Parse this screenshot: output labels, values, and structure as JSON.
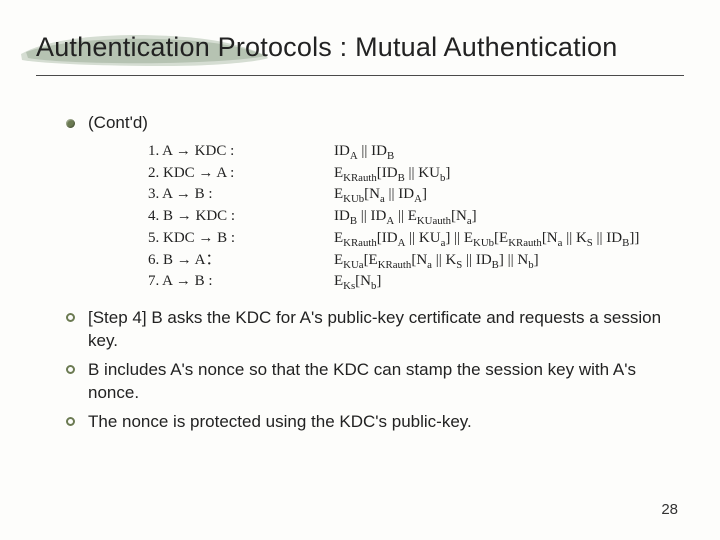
{
  "title": "Authentication Protocols : Mutual Authentication",
  "subhead": "(Cont'd)",
  "steps": [
    {
      "lhs": "1. A → KDC :",
      "rhs": "ID<sub>A</sub> || ID<sub>B</sub>"
    },
    {
      "lhs": "2. KDC → A :",
      "rhs": "E<sub>KRauth</sub>[ID<sub>B</sub> || KU<sub>b</sub>]"
    },
    {
      "lhs": "3. A → B :",
      "rhs": "E<sub>KUb</sub>[N<sub>a</sub> || ID<sub>A</sub>]"
    },
    {
      "lhs": "4. B → KDC :",
      "rhs": "ID<sub>B</sub> || ID<sub>A</sub> || E<sub>KUauth</sub>[N<sub>a</sub>]"
    },
    {
      "lhs": "5. KDC → B :",
      "rhs": "E<sub>KRauth</sub>[ID<sub>A</sub> || KU<sub>a</sub>] || E<sub>KUb</sub>[E<sub>KRauth</sub>[N<sub>a</sub> || K<sub>S</sub> || ID<sub>B</sub>]]"
    },
    {
      "lhs": "6. B → A：",
      "rhs": "E<sub>KUa</sub>[E<sub>KRauth</sub>[N<sub>a</sub> || K<sub>S</sub> || ID<sub>B</sub>] || N<sub>b</sub>]"
    },
    {
      "lhs": "7. A → B :",
      "rhs": "E<sub>Ks</sub>[N<sub>b</sub>]"
    }
  ],
  "notes": [
    "[Step 4] B asks the KDC for A's public-key certificate and requests a session key.",
    "B includes A's nonce so that the KDC can stamp the session key with A's nonce.",
    "The nonce is protected using the KDC's public-key."
  ],
  "page": "28"
}
